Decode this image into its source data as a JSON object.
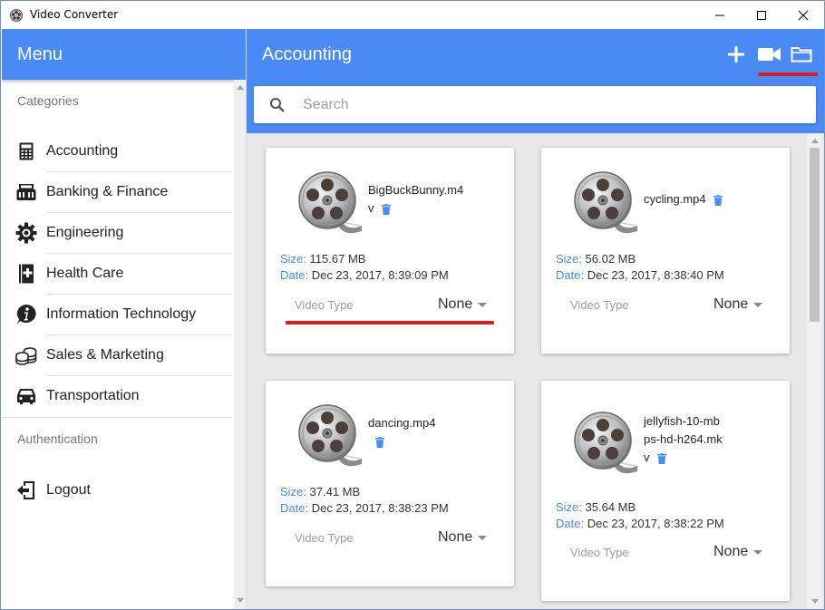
{
  "window": {
    "title": "Video Converter"
  },
  "sidebar": {
    "title": "Menu",
    "categories_label": "Categories",
    "items": [
      {
        "label": "Accounting",
        "icon": "calculator-icon"
      },
      {
        "label": "Banking & Finance",
        "icon": "bank-icon"
      },
      {
        "label": "Engineering",
        "icon": "gear-icon"
      },
      {
        "label": "Health Care",
        "icon": "medical-book-icon"
      },
      {
        "label": "Information Technology",
        "icon": "info-icon"
      },
      {
        "label": "Sales & Marketing",
        "icon": "coins-icon"
      },
      {
        "label": "Transportation",
        "icon": "car-icon"
      }
    ],
    "auth_label": "Authentication",
    "logout_label": "Logout"
  },
  "main": {
    "title": "Accounting",
    "search": {
      "placeholder": "Search",
      "value": ""
    },
    "accent_color": "#4a8af4",
    "highlight_color": "#e01d1d",
    "cards": [
      {
        "name": "BigBuckBunny.m4v",
        "size_label": "Size:",
        "size": "115.67 MB",
        "date_label": "Date:",
        "date": "Dec 23, 2017, 8:39:09 PM",
        "type_label": "Video Type",
        "type_value": "None"
      },
      {
        "name": "cycling.mp4",
        "size_label": "Size:",
        "size": "56.02 MB",
        "date_label": "Date:",
        "date": "Dec 23, 2017, 8:38:40 PM",
        "type_label": "Video Type",
        "type_value": "None"
      },
      {
        "name": "dancing.mp4",
        "size_label": "Size:",
        "size": "37.41 MB",
        "date_label": "Date:",
        "date": "Dec 23, 2017, 8:38:23 PM",
        "type_label": "Video Type",
        "type_value": "None"
      },
      {
        "name": "jellyfish-10-mbps-hd-h264.mkv",
        "size_label": "Size:",
        "size": "35.64 MB",
        "date_label": "Date:",
        "date": "Dec 23, 2017, 8:38:22 PM",
        "type_label": "Video Type",
        "type_value": "None"
      }
    ]
  }
}
